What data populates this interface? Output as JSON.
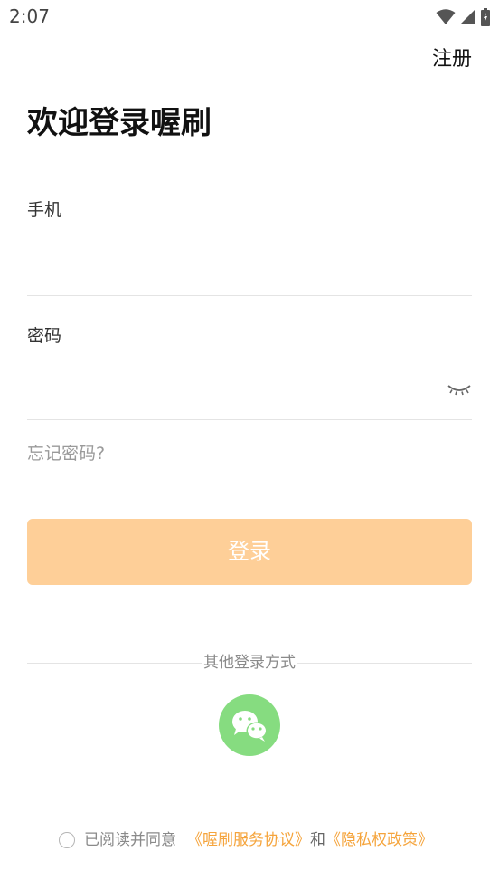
{
  "status_bar": {
    "time": "2:07",
    "icons": [
      "wifi-icon",
      "cell-signal-icon",
      "battery-charging-icon"
    ]
  },
  "header": {
    "register_label": "注册"
  },
  "title": "欢迎登录喔刷",
  "form": {
    "phone_label": "手机",
    "phone_value": "",
    "password_label": "密码",
    "password_value": "",
    "password_visibility_icon": "eye-closed-icon",
    "forgot_password_label": "忘记密码?"
  },
  "login_button_label": "登录",
  "other_login": {
    "label": "其他登录方式",
    "options": [
      {
        "name": "wechat",
        "icon": "wechat-icon"
      }
    ]
  },
  "agreement": {
    "checked": false,
    "prefix": "已阅读并同意",
    "service_link": "《喔刷服务协议》",
    "conjunction": "和",
    "privacy_link": "《隐私权政策》"
  },
  "colors": {
    "accent": "#fecf98",
    "link": "#f5a43c",
    "wechat_green": "#86dc80",
    "divider": "#e4e4e4",
    "muted_text": "#9a9a9a"
  }
}
